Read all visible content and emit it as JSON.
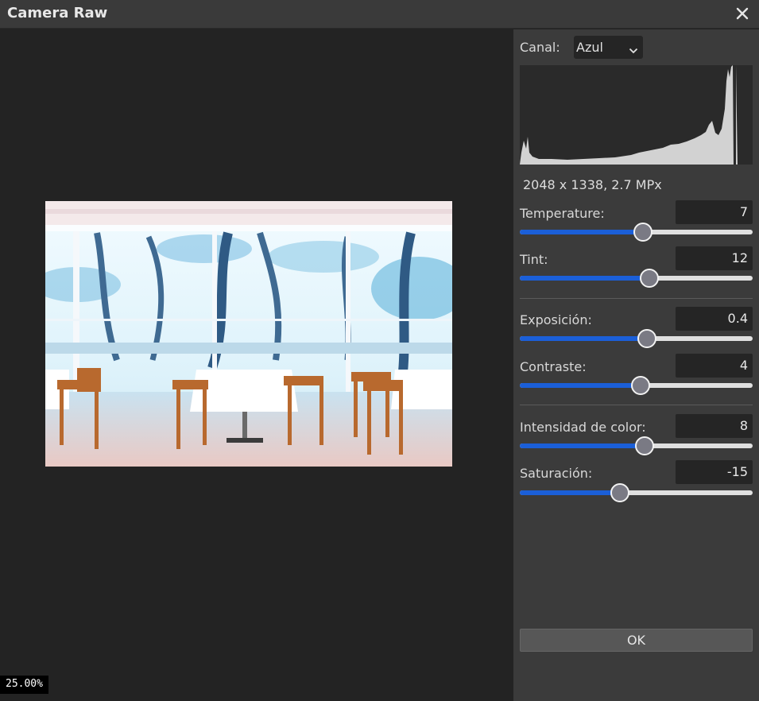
{
  "window": {
    "title": "Camera Raw"
  },
  "viewport": {
    "zoom": "25.00%"
  },
  "panel": {
    "canal_label": "Canal:",
    "canal_value": "Azul",
    "image_info": "2048 x 1338, 2.7 MPx",
    "controls": [
      {
        "label": "Temperature:",
        "value": "7",
        "fraction": 0.53
      },
      {
        "label": "Tint:",
        "value": "12",
        "fraction": 0.555
      },
      {
        "label": "Exposición:",
        "value": "0.4",
        "fraction": 0.545
      },
      {
        "label": "Contraste:",
        "value": "4",
        "fraction": 0.52
      },
      {
        "label": "Intensidad de color:",
        "value": "8",
        "fraction": 0.535
      },
      {
        "label": "Saturación:",
        "value": "-15",
        "fraction": 0.43
      }
    ],
    "ok_label": "OK"
  }
}
